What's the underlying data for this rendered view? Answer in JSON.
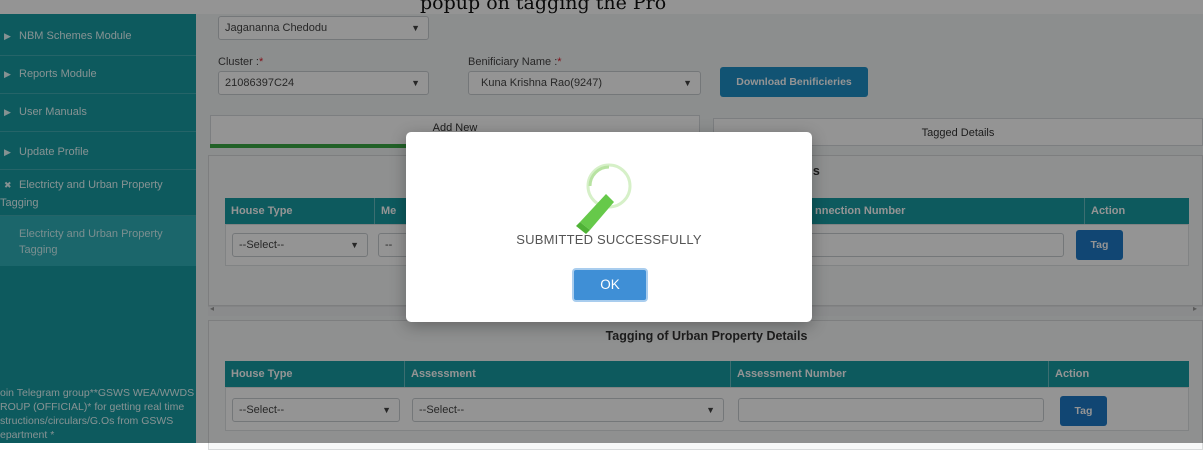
{
  "top_partial_text": "popup on tagging the Pro",
  "sidebar": {
    "items": [
      {
        "label": "NBM Schemes Module"
      },
      {
        "label": "Reports Module"
      },
      {
        "label": "User Manuals"
      },
      {
        "label": "Update Profile"
      },
      {
        "label_line1": "Electricty and Urban Property",
        "label_line2": "Tagging"
      }
    ],
    "sub_item_line1": "Electricty and Urban Property",
    "sub_item_line2": "Tagging",
    "footer_lines": [
      "oin Telegram group**GSWS WEA/WWDS",
      "ROUP (OFFICIAL)* for getting real time",
      "structions/circulars/G.Os from GSWS",
      "epartment *"
    ]
  },
  "form": {
    "top_select_value": "Jagananna Chedodu",
    "cluster_label": "Cluster :",
    "cluster_value": "21086397C24",
    "beneficiary_label": "Benificiary Name :",
    "beneficiary_value": "Kuna Krishna Rao(9247)",
    "required_marker": "*",
    "download_button": "Download Benificieries"
  },
  "tabs": [
    {
      "label": "Add New"
    },
    {
      "label": "Tagged Details"
    }
  ],
  "electricity_panel": {
    "title_visible": "ails",
    "columns": [
      "House Type",
      "Me",
      "nnection Number",
      "Action"
    ],
    "select_placeholder": "--Select--",
    "second_select_partial": "--",
    "tag_button": "Tag"
  },
  "urban_panel": {
    "title": "Tagging of Urban Property Details",
    "columns": [
      "House Type",
      "Assessment",
      "Assessment Number",
      "Action"
    ],
    "house_select": "--Select--",
    "assessment_select": "--Select--",
    "tag_button": "Tag"
  },
  "modal": {
    "message": "SUBMITTED SUCCESSFULLY",
    "ok_label": "OK"
  },
  "colors": {
    "teal": "#179ba3",
    "tag_blue": "#1e79c6",
    "success_green": "#66c94a",
    "tab_green": "#3aa744"
  }
}
